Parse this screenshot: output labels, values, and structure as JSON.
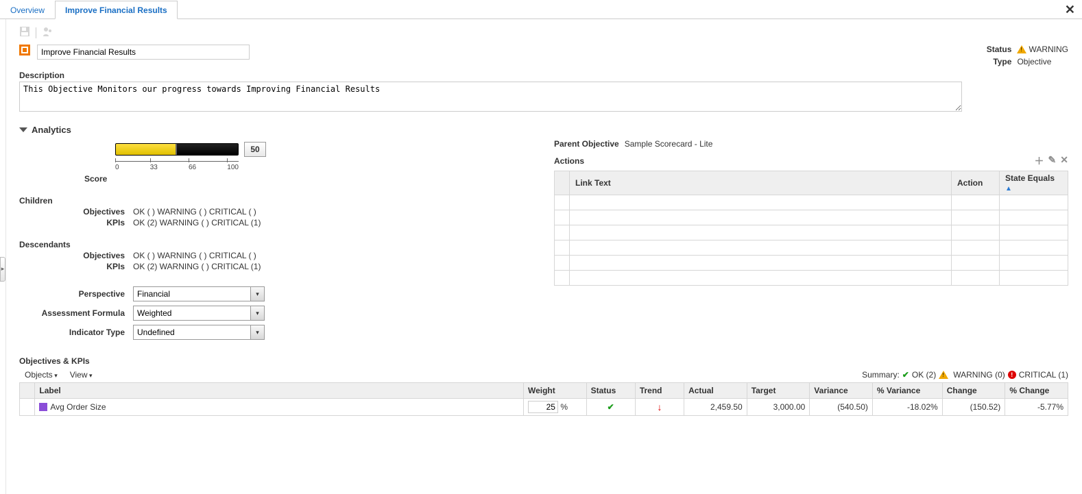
{
  "tabs": {
    "overview": "Overview",
    "active": "Improve Financial Results"
  },
  "title_value": "Improve Financial Results",
  "status_label": "Status",
  "status_value": "WARNING",
  "type_label": "Type",
  "type_value": "Objective",
  "desc_label": "Description",
  "desc_value": "This Objective Monitors our progress towards Improving Financial Results",
  "analytics": {
    "header": "Analytics",
    "score_label": "Score",
    "score_value": "50",
    "ticks": [
      "0",
      "33",
      "66",
      "100"
    ],
    "children_hdr": "Children",
    "descendants_hdr": "Descendants",
    "row_obj": "Objectives",
    "row_kpi": "KPIs",
    "objline": "OK ( )  WARNING ( )  CRITICAL ( )",
    "kpiline": "OK (2)  WARNING ( )  CRITICAL (1)",
    "persp_label": "Perspective",
    "persp_value": "Financial",
    "formula_label": "Assessment Formula",
    "formula_value": "Weighted",
    "ind_label": "Indicator Type",
    "ind_value": "Undefined"
  },
  "right": {
    "parent_label": "Parent Objective",
    "parent_value": "Sample Scorecard - Lite",
    "actions_label": "Actions",
    "cols": {
      "link": "Link Text",
      "action": "Action",
      "state": "State Equals"
    }
  },
  "okpi": {
    "header": "Objectives & KPIs",
    "menu_objects": "Objects",
    "menu_view": "View",
    "summary_label": "Summary:",
    "summary_ok": "OK (2)",
    "summary_warn": "WARNING (0)",
    "summary_crit": "CRITICAL (1)",
    "cols": {
      "label": "Label",
      "weight": "Weight",
      "status": "Status",
      "trend": "Trend",
      "actual": "Actual",
      "target": "Target",
      "variance": "Variance",
      "pvariance": "% Variance",
      "change": "Change",
      "pchange": "% Change"
    },
    "row": {
      "label": "Avg Order Size",
      "weight": "25",
      "weight_unit": "%",
      "actual": "2,459.50",
      "target": "3,000.00",
      "variance": "(540.50)",
      "pvariance": "-18.02%",
      "change": "(150.52)",
      "pchange": "-5.77%"
    }
  },
  "chart_data": {
    "type": "bar",
    "orientation": "horizontal",
    "title": "Score",
    "categories": [
      "Score"
    ],
    "values": [
      50
    ],
    "xlim": [
      0,
      100
    ],
    "ticks": [
      0,
      33,
      66,
      100
    ]
  }
}
